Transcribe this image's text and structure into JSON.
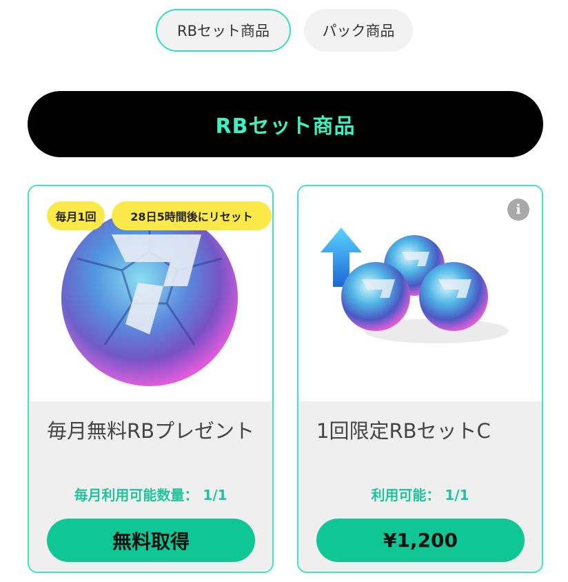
{
  "tabs": [
    {
      "label": "RBセット商品",
      "active": true
    },
    {
      "label": "パック商品",
      "active": false
    }
  ],
  "section_title": "RBセット商品",
  "products": [
    {
      "badges": [
        "毎月1回",
        "28日5時間後にリセット"
      ],
      "image": "soccer-ball-icon",
      "title": "毎月無料RBプレゼント",
      "quantity_text": "毎月利用可能数量： 1/1",
      "action_label": "無料取得"
    },
    {
      "badges": [],
      "info_icon": "i",
      "image": "three-balls-up-arrow-icon",
      "title": "1回限定RBセットC",
      "quantity_text": "利用可能： 1/1",
      "action_label": "¥1,200"
    }
  ],
  "colors": {
    "accent": "#3df2c2",
    "button": "#0fc795",
    "badge": "#fbe94a",
    "banner": "#000000"
  }
}
